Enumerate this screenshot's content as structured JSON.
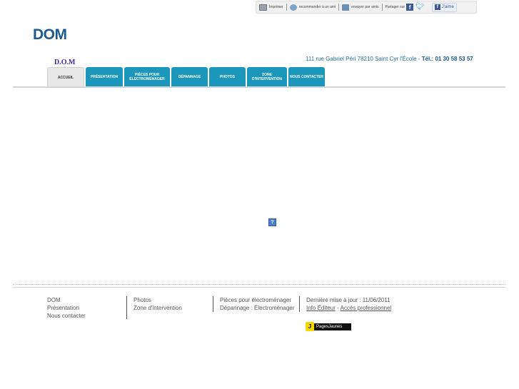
{
  "share_bar": {
    "print": "Imprimer",
    "recommend": "recommander à un ami",
    "send": "envoyer par amis",
    "share": "Partager sur",
    "like": "J'aime"
  },
  "header": {
    "logo": "DOM",
    "site_name": "D.O.M",
    "address": "111 rue Gabriel Péri 78210 Saint Cyr l'École",
    "dash": "-",
    "phone": "Tél.: 01 30 58 53 57"
  },
  "nav": {
    "tabs": [
      {
        "label": "ACCUEIL"
      },
      {
        "label": "PRÉSENTATION"
      },
      {
        "label": "PIÈCES POUR ÉLECTROMÉNAGER"
      },
      {
        "label": "DÉPANNAGE"
      },
      {
        "label": "PHOTOS"
      },
      {
        "label": "ZONE D'INTERVENTION"
      },
      {
        "label": "NOUS CONTACTER"
      }
    ],
    "active_index": 0
  },
  "main": {
    "broken_image_glyph": "?"
  },
  "footer": {
    "col1": [
      "DOM",
      "Présentation",
      "Nous contacter"
    ],
    "col2": [
      "Photos",
      "Zone d'intervention"
    ],
    "col3": [
      "Pièces pour électroménager",
      "Dépannage : Électroménager"
    ],
    "updated": "Dernière mise à jour : 11/06/2011",
    "info_editeur": "Info Éditeur",
    "link_sep": "-",
    "acces_pro": "Accès professionnel",
    "pj_letter": "J",
    "pj_text": "PagesJaunes"
  }
}
